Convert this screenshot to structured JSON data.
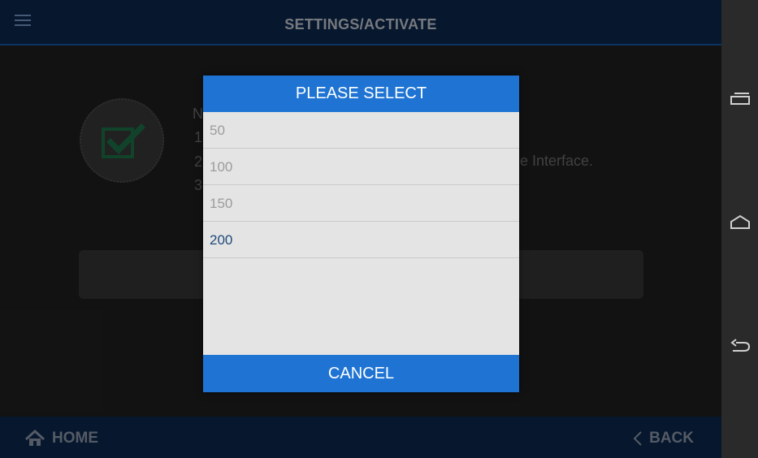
{
  "header": {
    "title": "SETTINGS/ACTIVATE",
    "menu_icon": "menu-icon"
  },
  "background": {
    "note_fragments": [
      "N",
      "1",
      "2",
      "3"
    ],
    "partial_text": "e Interface."
  },
  "dialog": {
    "title": "PLEASE SELECT",
    "options": [
      "50",
      "100",
      "150",
      "200"
    ],
    "selected": "200",
    "cancel_label": "CANCEL"
  },
  "footer": {
    "home_label": "HOME",
    "back_label": "BACK"
  },
  "colors": {
    "accent": "#1f74d3",
    "bar": "#0b2a55",
    "check": "#1f7a4f"
  }
}
